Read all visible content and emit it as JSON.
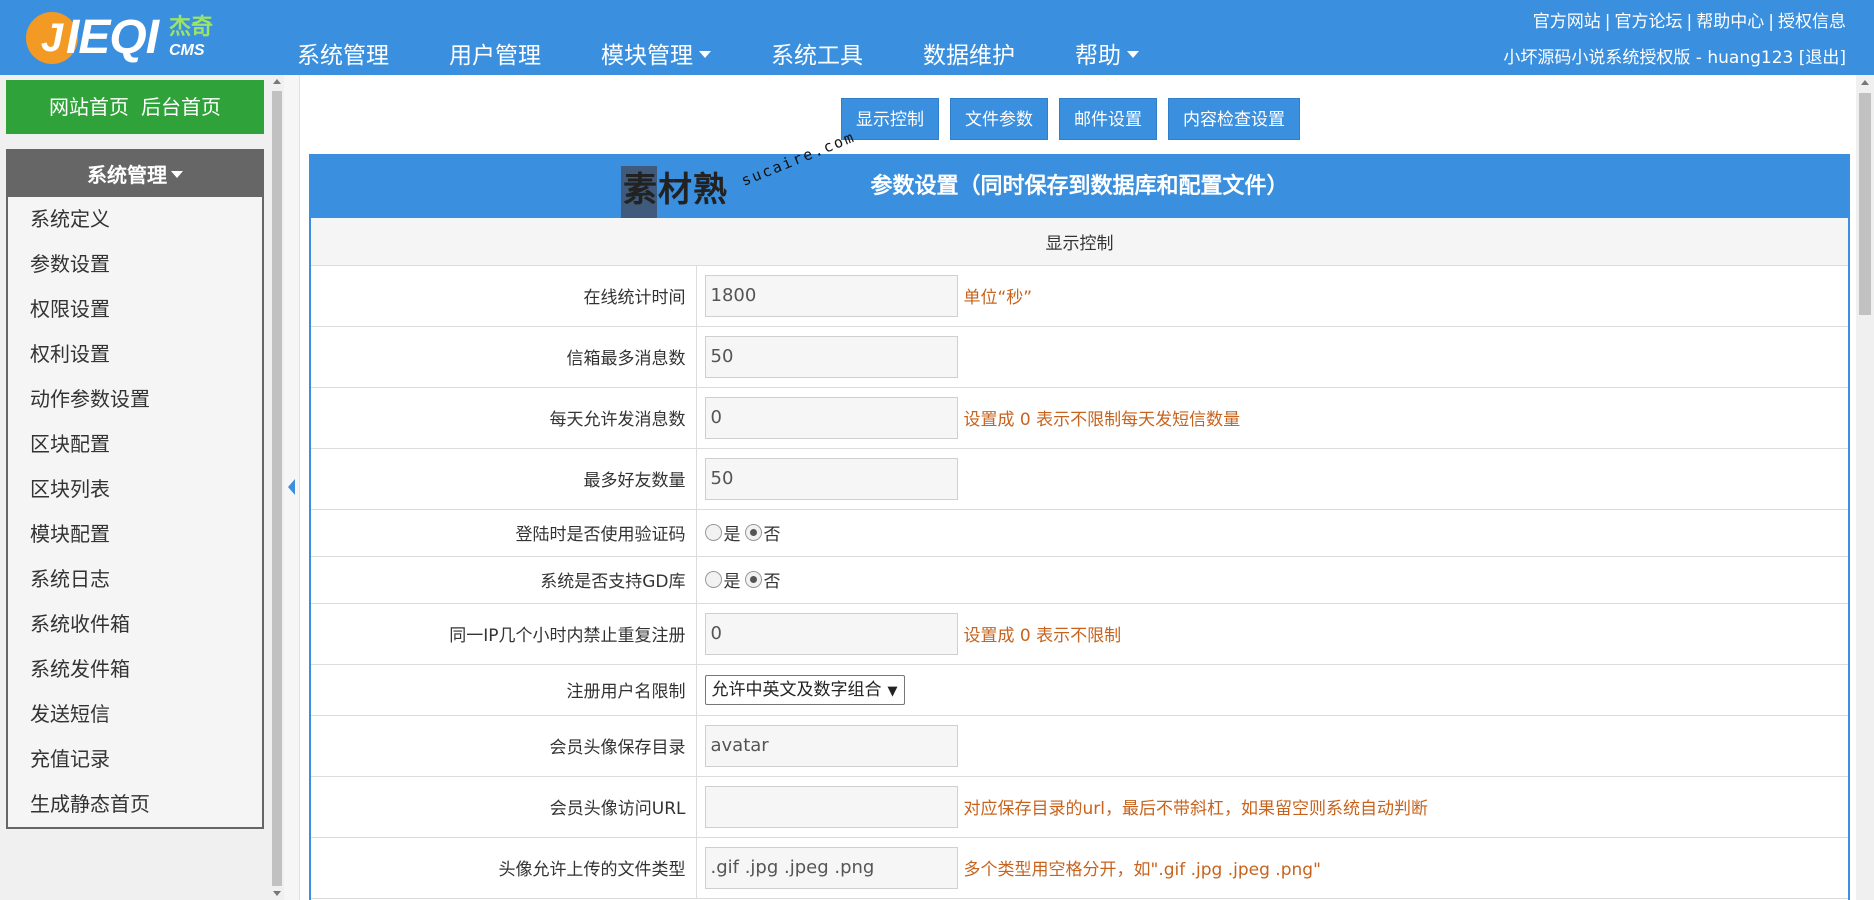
{
  "logo": {
    "letter": "J",
    "text": "IEQI",
    "cn": "杰奇",
    "cms": "CMS"
  },
  "nav": [
    {
      "label": "系统管理",
      "has_caret": false
    },
    {
      "label": "用户管理",
      "has_caret": false
    },
    {
      "label": "模块管理",
      "has_caret": true
    },
    {
      "label": "系统工具",
      "has_caret": false
    },
    {
      "label": "数据维护",
      "has_caret": false
    },
    {
      "label": "帮助",
      "has_caret": true
    }
  ],
  "top_links": [
    "官方网站",
    "官方论坛",
    "帮助中心",
    "授权信息"
  ],
  "top_links_sep": "|",
  "top_user": "小坏源码小说系统授权版 - huang123 [退出]",
  "sidebar": {
    "quick_links": [
      "网站首页",
      "后台首页"
    ],
    "menu_title": "系统管理",
    "items": [
      "系统定义",
      "参数设置",
      "权限设置",
      "权利设置",
      "动作参数设置",
      "区块配置",
      "区块列表",
      "模块配置",
      "系统日志",
      "系统收件箱",
      "系统发件箱",
      "发送短信",
      "充值记录",
      "生成静态首页"
    ]
  },
  "tabs": [
    "显示控制",
    "文件参数",
    "邮件设置",
    "内容检查设置"
  ],
  "panel": {
    "title": "参数设置（同时保存到数据库和配置文件）",
    "watermark": {
      "text": "素材熟",
      "url": "sucaire.com"
    },
    "section": "显示控制",
    "rows": [
      {
        "label": "在线统计时间",
        "value": "1800",
        "hint": "单位“秒”"
      },
      {
        "label": "信箱最多消息数",
        "value": "50",
        "hint": ""
      },
      {
        "label": "每天允许发消息数",
        "value": "0",
        "hint": "设置成 0 表示不限制每天发短信数量"
      },
      {
        "label": "最多好友数量",
        "value": "50",
        "hint": ""
      },
      {
        "label": "登陆时是否使用验证码",
        "radio_yes": "是",
        "radio_no": "否"
      },
      {
        "label": "系统是否支持GD库",
        "radio_yes": "是",
        "radio_no": "否"
      },
      {
        "label": "同一IP几个小时内禁止重复注册",
        "value": "0",
        "hint": "设置成 0 表示不限制"
      },
      {
        "label": "注册用户名限制",
        "select": "允许中英文及数字组合"
      },
      {
        "label": "会员头像保存目录",
        "value": "avatar",
        "hint": ""
      },
      {
        "label": "会员头像访问URL",
        "value": "",
        "hint": "对应保存目录的url，最后不带斜杠，如果留空则系统自动判断"
      },
      {
        "label": "头像允许上传的文件类型",
        "value": ".gif .jpg .jpeg .png",
        "hint": "多个类型用空格分开，如\".gif .jpg .jpeg .png\""
      }
    ]
  },
  "colors": {
    "header": "#3a8fde",
    "quick_links": "#2fa33a",
    "hint": "#c8631d",
    "menu_head": "#666666"
  }
}
